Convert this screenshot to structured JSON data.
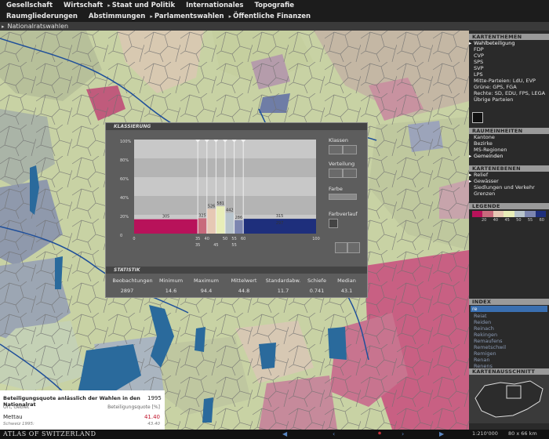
{
  "menu": {
    "row1": [
      "Gesellschaft",
      "Wirtschaft",
      "Staat und Politik",
      "Internationales",
      "Topografie"
    ],
    "row2": [
      "Raumgliederungen",
      "Abstimmungen",
      "Parlamentswahlen",
      "Öffentliche Finanzen"
    ]
  },
  "breadcrumb": "Nationalratswahlen",
  "sidebar": {
    "kartenthemen": {
      "title": "KARTENTHEMEN",
      "items": [
        "Wahlbeteiligung",
        "FDP",
        "CVP",
        "SPS",
        "SVP",
        "LPS",
        "Mitte-Parteien: LdU, EVP",
        "Grüne: GPS, FGA",
        "Rechte: SD, EDU, FPS, LEGA",
        "Übrige Parteien"
      ],
      "active": 0
    },
    "raumeinheiten": {
      "title": "RAUMEINHEITEN",
      "items": [
        "Kantone",
        "Bezirke",
        "MS-Regionen",
        "Gemeinden"
      ],
      "active": 3
    },
    "kartenebenen": {
      "title": "KARTENEBENEN",
      "items": [
        "Relief",
        "Gewässer",
        "Siedlungen und Verkehr",
        "Grenzen"
      ]
    },
    "legende": {
      "title": "LEGENDE",
      "labels": [
        "20",
        "40",
        "45",
        "50",
        "55",
        "60"
      ]
    },
    "index": {
      "title": "INDEX",
      "search": "re",
      "items": [
        "Reiat",
        "Reiden",
        "Reinach",
        "Rekingen",
        "Remaufens",
        "Remetschwil",
        "Remigen",
        "Renan",
        "Renens"
      ]
    },
    "kartenausschnitt": {
      "title": "KARTENAUSSCHNITT"
    }
  },
  "dialog": {
    "title": "KLASSIERUNG",
    "yaxis": [
      "100%",
      "80%",
      "60%",
      "40%",
      "20%",
      "0"
    ],
    "controls": [
      "Klassen",
      "Verteilung",
      "Farbe",
      "Farbverlauf"
    ],
    "stats_title": "STATISTIK",
    "stats_headers": [
      "Beobachtungen",
      "Minimum",
      "Maximum",
      "Mittelwert",
      "Standardabw.",
      "Schiefe",
      "Median"
    ],
    "stats_values": [
      "2897",
      "14.6",
      "94.4",
      "44.8",
      "11.7",
      "0.741",
      "43.1"
    ]
  },
  "chart_data": {
    "type": "bar",
    "categories": [
      "0–35",
      "35–40",
      "40–45",
      "45–50",
      "50–55",
      "55–60",
      "60–100"
    ],
    "values": [
      305,
      325,
      526,
      581,
      442,
      286,
      315
    ],
    "bar_labels": [
      "305",
      "325",
      "526",
      "581",
      "442",
      "286",
      "315"
    ],
    "extra_label": "297",
    "class_breaks": [
      0,
      35,
      40,
      45,
      50,
      55,
      60,
      100
    ],
    "tick_labels_top": [
      "0",
      "35",
      "40",
      "50",
      "55",
      "60",
      "100"
    ],
    "tick_labels_bottom": [
      "35",
      "45",
      "55"
    ],
    "colors": [
      "#b8125a",
      "#c86a7c",
      "#e6c8b4",
      "#e8eeb8",
      "#b8c4cc",
      "#7c86b0",
      "#1e2f7c"
    ],
    "ylim": [
      0,
      100
    ]
  },
  "infopanel": {
    "title": "Beteiligungsquote anlässlich der Wahlen in den Nationalrat",
    "year": "1995",
    "col1": "Ort, Gebiet",
    "col2": "Beteiligungsquote [%]",
    "place": "Mettau",
    "value": "41.40",
    "sub_label": "Schweiz 1995:",
    "sub_value": "43.40"
  },
  "status": {
    "atlas": "ATLAS OF SWITZERLAND",
    "scale": "1:210'000",
    "size": "80 x 66 km"
  },
  "colors": {
    "accent": "#3a6fb0",
    "menubar": "#1c1c1c"
  }
}
